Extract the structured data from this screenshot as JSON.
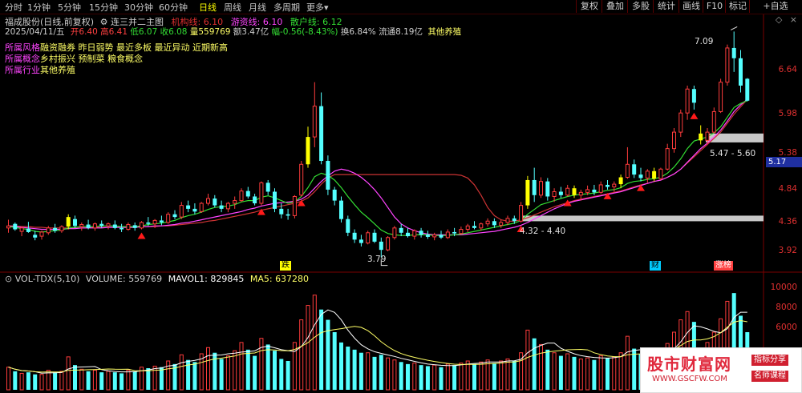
{
  "periods": [
    "分时",
    "1分钟",
    "5分钟",
    "15分钟",
    "30分钟",
    "60分钟",
    "日线",
    "周线",
    "月线",
    "多周期",
    "更多▾"
  ],
  "active_period": "日线",
  "toolbar": [
    "复权",
    "叠加",
    "多股",
    "统计",
    "画线",
    "F10",
    "标记",
    "+自选"
  ],
  "header": {
    "stock": "福成股份(日线,前复权)",
    "indicator": "连三并二主图",
    "jg_label": "机构线:",
    "jg_value": "6.10",
    "yz_label": "游资线:",
    "yz_value": "6.10",
    "sh_label": "散户线:",
    "sh_value": "6.12",
    "date": "2025/04/11/五",
    "open_label": "开",
    "open": "6.40",
    "high_label": "高",
    "high": "6.41",
    "low_label": "低",
    "low": "6.07",
    "close_label": "收",
    "close": "6.08",
    "vol_label": "量",
    "vol": "559769",
    "amt_label": "额",
    "amt": "3.47亿",
    "chg_label": "幅",
    "chg": "-0.56(-8.43%)",
    "turn_label": "换",
    "turn": "6.84%",
    "float_label": "流通",
    "float": "8.19亿",
    "extra": "其他养殖"
  },
  "categories": [
    {
      "label": "所属风格",
      "value": "融资融券 昨日弱势 最近多板 最近异动 近期新高"
    },
    {
      "label": "所属概念",
      "value": "乡村振兴 预制菜 粮食概念"
    },
    {
      "label": "所属行业",
      "value": "其他养殖"
    }
  ],
  "price_axis": [
    "6.64",
    "5.98",
    "5.38",
    "4.84",
    "4.36",
    "3.92"
  ],
  "current_price": "5.17",
  "annotations": {
    "high_mark": "7.09",
    "low_mark": "3.79",
    "box1": "5.47 - 5.60",
    "box2": "4.32 - 4.40"
  },
  "event_badges": [
    {
      "text": "跌",
      "color": "#ffff00"
    },
    {
      "text": "财",
      "color": "#00ccff"
    },
    {
      "text": "涨榜",
      "color": "#ff4040"
    }
  ],
  "volume": {
    "title": "VOL-TDX(5,10)",
    "vol_label": "VOLUME:",
    "vol_value": "559769",
    "mavol1_label": "MAVOL1:",
    "mavol1_value": "829845",
    "ma5_label": "MA5:",
    "ma5_value": "637280",
    "axis": [
      "10000",
      "8000",
      "6000"
    ]
  },
  "watermark": {
    "title": "股市财富网",
    "url": "WWW.GSCFW.COM",
    "tag1": "指标分享",
    "tag2": "名师课程"
  },
  "colors": {
    "up": "#ff3c3c",
    "down": "#54ffff",
    "signal": "#ffff00",
    "line_jg": "#cc3333",
    "line_yz": "#ff44ff",
    "line_sh": "#33dd33"
  },
  "chart_data": {
    "type": "candlestick",
    "ylim": [
      3.75,
      7.2
    ],
    "candles": [
      {
        "o": 4.22,
        "h": 4.34,
        "l": 4.15,
        "c": 4.25
      },
      {
        "o": 4.28,
        "h": 4.3,
        "l": 4.18,
        "c": 4.2
      },
      {
        "o": 4.17,
        "h": 4.24,
        "l": 4.1,
        "c": 4.22
      },
      {
        "o": 4.21,
        "h": 4.31,
        "l": 4.15,
        "c": 4.16
      },
      {
        "o": 4.12,
        "h": 4.18,
        "l": 4.04,
        "c": 4.08
      },
      {
        "o": 4.1,
        "h": 4.18,
        "l": 4.05,
        "c": 4.16
      },
      {
        "o": 4.15,
        "h": 4.25,
        "l": 4.12,
        "c": 4.22
      },
      {
        "o": 4.22,
        "h": 4.28,
        "l": 4.15,
        "c": 4.18
      },
      {
        "o": 4.18,
        "h": 4.26,
        "l": 4.15,
        "c": 4.24
      },
      {
        "o": 4.24,
        "h": 4.42,
        "l": 4.2,
        "c": 4.38
      },
      {
        "o": 4.35,
        "h": 4.4,
        "l": 4.22,
        "c": 4.25
      },
      {
        "o": 4.24,
        "h": 4.3,
        "l": 4.18,
        "c": 4.27
      },
      {
        "o": 4.27,
        "h": 4.34,
        "l": 4.2,
        "c": 4.22
      },
      {
        "o": 4.22,
        "h": 4.3,
        "l": 4.18,
        "c": 4.28
      },
      {
        "o": 4.28,
        "h": 4.33,
        "l": 4.22,
        "c": 4.25
      },
      {
        "o": 4.25,
        "h": 4.3,
        "l": 4.2,
        "c": 4.28
      },
      {
        "o": 4.27,
        "h": 4.33,
        "l": 4.2,
        "c": 4.22
      },
      {
        "o": 4.22,
        "h": 4.28,
        "l": 4.16,
        "c": 4.2
      },
      {
        "o": 4.2,
        "h": 4.3,
        "l": 4.18,
        "c": 4.27
      },
      {
        "o": 4.26,
        "h": 4.3,
        "l": 4.18,
        "c": 4.22
      },
      {
        "o": 4.22,
        "h": 4.32,
        "l": 4.2,
        "c": 4.3
      },
      {
        "o": 4.3,
        "h": 4.38,
        "l": 4.25,
        "c": 4.28
      },
      {
        "o": 4.28,
        "h": 4.35,
        "l": 4.22,
        "c": 4.33
      },
      {
        "o": 4.33,
        "h": 4.4,
        "l": 4.26,
        "c": 4.3
      },
      {
        "o": 4.3,
        "h": 4.45,
        "l": 4.28,
        "c": 4.42
      },
      {
        "o": 4.42,
        "h": 4.48,
        "l": 4.35,
        "c": 4.38
      },
      {
        "o": 4.38,
        "h": 4.6,
        "l": 4.35,
        "c": 4.55
      },
      {
        "o": 4.55,
        "h": 4.62,
        "l": 4.45,
        "c": 4.5
      },
      {
        "o": 4.5,
        "h": 4.58,
        "l": 4.42,
        "c": 4.46
      },
      {
        "o": 4.46,
        "h": 4.6,
        "l": 4.44,
        "c": 4.58
      },
      {
        "o": 4.58,
        "h": 4.72,
        "l": 4.55,
        "c": 4.65
      },
      {
        "o": 4.65,
        "h": 4.7,
        "l": 4.52,
        "c": 4.55
      },
      {
        "o": 4.55,
        "h": 4.62,
        "l": 4.45,
        "c": 4.5
      },
      {
        "o": 4.5,
        "h": 4.6,
        "l": 4.45,
        "c": 4.58
      },
      {
        "o": 4.58,
        "h": 4.68,
        "l": 4.5,
        "c": 4.62
      },
      {
        "o": 4.62,
        "h": 4.8,
        "l": 4.6,
        "c": 4.76
      },
      {
        "o": 4.76,
        "h": 4.82,
        "l": 4.65,
        "c": 4.68
      },
      {
        "o": 4.68,
        "h": 4.72,
        "l": 4.55,
        "c": 4.58
      },
      {
        "o": 4.58,
        "h": 4.9,
        "l": 4.55,
        "c": 4.88
      },
      {
        "o": 4.88,
        "h": 4.92,
        "l": 4.7,
        "c": 4.75
      },
      {
        "o": 4.75,
        "h": 4.8,
        "l": 4.45,
        "c": 4.5
      },
      {
        "o": 4.5,
        "h": 4.58,
        "l": 4.36,
        "c": 4.42
      },
      {
        "o": 4.42,
        "h": 4.5,
        "l": 4.34,
        "c": 4.4
      },
      {
        "o": 4.4,
        "h": 4.7,
        "l": 4.36,
        "c": 4.68
      },
      {
        "o": 4.7,
        "h": 5.2,
        "l": 4.68,
        "c": 5.15
      },
      {
        "o": 5.15,
        "h": 5.7,
        "l": 5.1,
        "c": 5.55
      },
      {
        "o": 5.55,
        "h": 6.35,
        "l": 5.4,
        "c": 6.0
      },
      {
        "o": 6.0,
        "h": 6.2,
        "l": 5.15,
        "c": 5.2
      },
      {
        "o": 5.2,
        "h": 5.28,
        "l": 4.7,
        "c": 4.78
      },
      {
        "o": 4.78,
        "h": 4.82,
        "l": 4.55,
        "c": 4.62
      },
      {
        "o": 4.62,
        "h": 4.68,
        "l": 4.3,
        "c": 4.35
      },
      {
        "o": 4.35,
        "h": 4.4,
        "l": 4.1,
        "c": 4.15
      },
      {
        "o": 4.15,
        "h": 4.2,
        "l": 4.0,
        "c": 4.05
      },
      {
        "o": 4.05,
        "h": 4.12,
        "l": 3.95,
        "c": 4.0
      },
      {
        "o": 4.0,
        "h": 4.18,
        "l": 3.98,
        "c": 4.15
      },
      {
        "o": 4.15,
        "h": 4.2,
        "l": 4.0,
        "c": 4.02
      },
      {
        "o": 4.02,
        "h": 4.08,
        "l": 3.79,
        "c": 3.9
      },
      {
        "o": 3.9,
        "h": 4.1,
        "l": 3.88,
        "c": 4.08
      },
      {
        "o": 4.08,
        "h": 4.25,
        "l": 4.05,
        "c": 4.22
      },
      {
        "o": 4.22,
        "h": 4.28,
        "l": 4.1,
        "c": 4.15
      },
      {
        "o": 4.15,
        "h": 4.22,
        "l": 4.08,
        "c": 4.1
      },
      {
        "o": 4.1,
        "h": 4.2,
        "l": 4.05,
        "c": 4.18
      },
      {
        "o": 4.18,
        "h": 4.22,
        "l": 4.08,
        "c": 4.12
      },
      {
        "o": 4.12,
        "h": 4.18,
        "l": 4.06,
        "c": 4.09
      },
      {
        "o": 4.09,
        "h": 4.15,
        "l": 4.04,
        "c": 4.12
      },
      {
        "o": 4.12,
        "h": 4.18,
        "l": 4.06,
        "c": 4.08
      },
      {
        "o": 4.08,
        "h": 4.2,
        "l": 4.06,
        "c": 4.16
      },
      {
        "o": 4.16,
        "h": 4.22,
        "l": 4.1,
        "c": 4.14
      },
      {
        "o": 4.14,
        "h": 4.24,
        "l": 4.12,
        "c": 4.2
      },
      {
        "o": 4.2,
        "h": 4.28,
        "l": 4.16,
        "c": 4.25
      },
      {
        "o": 4.25,
        "h": 4.32,
        "l": 4.2,
        "c": 4.22
      },
      {
        "o": 4.22,
        "h": 4.3,
        "l": 4.18,
        "c": 4.28
      },
      {
        "o": 4.28,
        "h": 4.36,
        "l": 4.24,
        "c": 4.32
      },
      {
        "o": 4.32,
        "h": 4.36,
        "l": 4.22,
        "c": 4.26
      },
      {
        "o": 4.26,
        "h": 4.34,
        "l": 4.22,
        "c": 4.3
      },
      {
        "o": 4.3,
        "h": 4.4,
        "l": 4.26,
        "c": 4.36
      },
      {
        "o": 4.36,
        "h": 4.4,
        "l": 4.28,
        "c": 4.32
      },
      {
        "o": 4.32,
        "h": 4.6,
        "l": 4.3,
        "c": 4.55
      },
      {
        "o": 4.55,
        "h": 4.98,
        "l": 4.5,
        "c": 4.92
      },
      {
        "o": 4.92,
        "h": 5.1,
        "l": 4.6,
        "c": 4.7
      },
      {
        "o": 4.7,
        "h": 4.96,
        "l": 4.66,
        "c": 4.9
      },
      {
        "o": 4.9,
        "h": 4.95,
        "l": 4.62,
        "c": 4.68
      },
      {
        "o": 4.68,
        "h": 4.8,
        "l": 4.6,
        "c": 4.75
      },
      {
        "o": 4.75,
        "h": 4.82,
        "l": 4.66,
        "c": 4.7
      },
      {
        "o": 4.7,
        "h": 4.85,
        "l": 4.68,
        "c": 4.8
      },
      {
        "o": 4.8,
        "h": 4.84,
        "l": 4.66,
        "c": 4.7
      },
      {
        "o": 4.7,
        "h": 4.78,
        "l": 4.62,
        "c": 4.74
      },
      {
        "o": 4.74,
        "h": 4.84,
        "l": 4.7,
        "c": 4.78
      },
      {
        "o": 4.78,
        "h": 4.85,
        "l": 4.7,
        "c": 4.74
      },
      {
        "o": 4.74,
        "h": 4.9,
        "l": 4.72,
        "c": 4.85
      },
      {
        "o": 4.85,
        "h": 4.92,
        "l": 4.78,
        "c": 4.82
      },
      {
        "o": 4.82,
        "h": 4.9,
        "l": 4.75,
        "c": 4.86
      },
      {
        "o": 4.86,
        "h": 5.0,
        "l": 4.8,
        "c": 4.96
      },
      {
        "o": 4.96,
        "h": 5.4,
        "l": 4.94,
        "c": 5.15
      },
      {
        "o": 5.15,
        "h": 5.22,
        "l": 4.95,
        "c": 5.0
      },
      {
        "o": 5.0,
        "h": 5.1,
        "l": 4.9,
        "c": 4.95
      },
      {
        "o": 4.95,
        "h": 5.08,
        "l": 4.88,
        "c": 5.05
      },
      {
        "o": 5.05,
        "h": 5.1,
        "l": 4.9,
        "c": 4.94
      },
      {
        "o": 4.94,
        "h": 5.1,
        "l": 4.92,
        "c": 5.08
      },
      {
        "o": 5.08,
        "h": 5.45,
        "l": 5.06,
        "c": 5.38
      },
      {
        "o": 5.38,
        "h": 5.68,
        "l": 5.32,
        "c": 5.62
      },
      {
        "o": 5.62,
        "h": 5.95,
        "l": 5.55,
        "c": 5.9
      },
      {
        "o": 5.9,
        "h": 6.3,
        "l": 5.8,
        "c": 6.25
      },
      {
        "o": 6.25,
        "h": 6.3,
        "l": 5.95,
        "c": 6.05
      },
      {
        "o": 5.6,
        "h": 5.72,
        "l": 5.44,
        "c": 5.5
      },
      {
        "o": 5.5,
        "h": 5.68,
        "l": 5.45,
        "c": 5.62
      },
      {
        "o": 5.62,
        "h": 5.98,
        "l": 5.6,
        "c": 5.92
      },
      {
        "o": 5.92,
        "h": 6.4,
        "l": 5.9,
        "c": 6.35
      },
      {
        "o": 6.35,
        "h": 6.9,
        "l": 6.3,
        "c": 6.85
      },
      {
        "o": 6.85,
        "h": 7.09,
        "l": 6.5,
        "c": 6.7
      },
      {
        "o": 6.7,
        "h": 6.82,
        "l": 6.2,
        "c": 6.3
      },
      {
        "o": 6.4,
        "h": 6.41,
        "l": 6.07,
        "c": 6.08
      }
    ],
    "signal_bars": [
      9,
      45,
      78,
      85,
      92,
      97,
      104
    ],
    "triangles": [
      20,
      38,
      44,
      77,
      84,
      90,
      95,
      103
    ],
    "volumes": [
      2200,
      1800,
      1600,
      1700,
      1500,
      1500,
      1900,
      1700,
      1800,
      3200,
      2400,
      2000,
      1800,
      1900,
      1700,
      1800,
      1700,
      1600,
      1900,
      1800,
      2200,
      2100,
      2300,
      2200,
      2800,
      2500,
      3400,
      2900,
      2700,
      3500,
      4100,
      3600,
      3000,
      3300,
      3800,
      4600,
      3900,
      3300,
      5000,
      4400,
      3800,
      3000,
      2800,
      4600,
      6800,
      8200,
      9200,
      7800,
      6800,
      5600,
      4600,
      4200,
      3900,
      3600,
      3600,
      3200,
      3400,
      3100,
      2900,
      2700,
      2500,
      2600,
      2400,
      2300,
      2400,
      2200,
      2500,
      2400,
      2600,
      2800,
      2500,
      2700,
      2900,
      2600,
      2800,
      3000,
      2800,
      3600,
      5800,
      5000,
      4400,
      3900,
      3600,
      3300,
      3500,
      3200,
      3000,
      3100,
      2900,
      3300,
      3100,
      3200,
      3600,
      5200,
      4000,
      3500,
      3400,
      3100,
      3300,
      4500,
      5600,
      6800,
      7600,
      6600,
      4000,
      4600,
      5600,
      6900,
      8600,
      9400,
      7200,
      5600
    ],
    "sh_line": [
      4.24,
      4.23,
      4.21,
      4.2,
      4.17,
      4.16,
      4.17,
      4.18,
      4.19,
      4.22,
      4.23,
      4.24,
      4.24,
      4.24,
      4.25,
      4.25,
      4.25,
      4.24,
      4.24,
      4.24,
      4.25,
      4.27,
      4.28,
      4.29,
      4.31,
      4.33,
      4.37,
      4.4,
      4.42,
      4.45,
      4.49,
      4.52,
      4.53,
      4.54,
      4.56,
      4.6,
      4.62,
      4.62,
      4.67,
      4.69,
      4.66,
      4.62,
      4.58,
      4.6,
      4.68,
      4.81,
      4.97,
      5.02,
      4.99,
      4.92,
      4.81,
      4.68,
      4.56,
      4.45,
      4.37,
      4.28,
      4.19,
      4.14,
      4.12,
      4.11,
      4.11,
      4.12,
      4.12,
      4.12,
      4.11,
      4.11,
      4.11,
      4.12,
      4.13,
      4.15,
      4.17,
      4.19,
      4.21,
      4.23,
      4.25,
      4.27,
      4.29,
      4.33,
      4.42,
      4.49,
      4.56,
      4.59,
      4.62,
      4.65,
      4.68,
      4.7,
      4.71,
      4.72,
      4.73,
      4.75,
      4.77,
      4.78,
      4.81,
      4.87,
      4.9,
      4.91,
      4.93,
      4.94,
      4.96,
      5.02,
      5.11,
      5.23,
      5.38,
      5.49,
      5.52,
      5.55,
      5.61,
      5.7,
      5.84,
      5.98,
      6.04,
      6.08
    ],
    "yz_line": [
      4.25,
      4.24,
      4.23,
      4.22,
      4.21,
      4.2,
      4.2,
      4.2,
      4.2,
      4.21,
      4.21,
      4.22,
      4.22,
      4.22,
      4.22,
      4.23,
      4.23,
      4.23,
      4.23,
      4.23,
      4.24,
      4.24,
      4.25,
      4.25,
      4.26,
      4.27,
      4.29,
      4.3,
      4.32,
      4.34,
      4.36,
      4.38,
      4.4,
      4.42,
      4.44,
      4.46,
      4.49,
      4.51,
      4.54,
      4.56,
      4.58,
      4.59,
      4.6,
      4.61,
      4.64,
      4.7,
      4.8,
      4.9,
      4.98,
      5.05,
      5.08,
      5.06,
      5.02,
      4.96,
      4.88,
      4.78,
      4.66,
      4.52,
      4.38,
      4.28,
      4.22,
      4.18,
      4.15,
      4.13,
      4.12,
      4.12,
      4.12,
      4.12,
      4.12,
      4.13,
      4.14,
      4.15,
      4.16,
      4.17,
      4.19,
      4.21,
      4.23,
      4.26,
      4.3,
      4.35,
      4.4,
      4.45,
      4.5,
      4.54,
      4.58,
      4.61,
      4.63,
      4.65,
      4.67,
      4.69,
      4.71,
      4.73,
      4.75,
      4.78,
      4.81,
      4.84,
      4.87,
      4.9,
      4.92,
      4.96,
      5.01,
      5.08,
      5.18,
      5.28,
      5.38,
      5.46,
      5.55,
      5.65,
      5.78,
      5.92,
      6.02,
      6.1
    ],
    "jg_line": [
      4.25,
      4.25,
      4.24,
      4.24,
      4.23,
      4.23,
      4.22,
      4.22,
      4.22,
      4.22,
      4.22,
      4.22,
      4.22,
      4.23,
      4.23,
      4.23,
      4.23,
      4.23,
      4.23,
      4.23,
      4.24,
      4.24,
      4.24,
      4.25,
      4.25,
      4.26,
      4.27,
      4.28,
      4.29,
      4.3,
      4.32,
      4.33,
      4.35,
      4.37,
      4.39,
      4.41,
      4.43,
      4.45,
      4.48,
      4.5,
      4.52,
      4.54,
      4.56,
      4.58,
      4.61,
      4.66,
      4.75,
      4.86,
      4.95,
      5.0,
      5.0,
      5.0,
      5.0,
      5.0,
      5.0,
      5.0,
      5.0,
      5.0,
      5.0,
      5.0,
      5.0,
      5.0,
      5.0,
      5.0,
      5.0,
      5.0,
      5.0,
      5.0,
      4.99,
      4.95,
      4.85,
      4.7,
      4.52,
      4.4,
      4.34,
      4.32,
      4.32,
      4.34,
      4.37,
      4.41,
      4.45,
      4.49,
      4.53,
      4.56,
      4.59,
      4.62,
      4.64,
      4.66,
      4.68,
      4.7,
      4.72,
      4.74,
      4.76,
      4.79,
      4.82,
      4.85,
      4.87,
      4.9,
      4.92,
      4.96,
      5.01,
      5.08,
      5.17,
      5.26,
      5.35,
      5.44,
      5.53,
      5.62,
      5.75,
      5.88,
      5.99,
      6.1
    ]
  }
}
